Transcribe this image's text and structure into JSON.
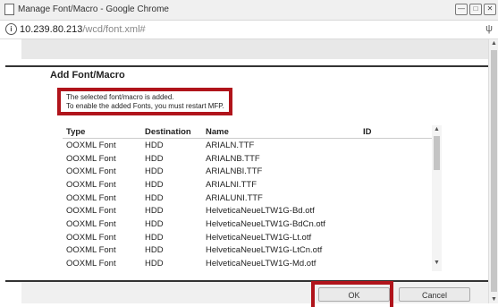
{
  "window": {
    "title": "Manage Font/Macro - Google Chrome",
    "minimize_glyph": "—",
    "maximize_glyph": "□",
    "close_glyph": "✕"
  },
  "address_bar": {
    "info_glyph": "i",
    "host": "10.239.80.213",
    "path": "/wcd/font.xml#",
    "extension_glyph": "ψ"
  },
  "dialog": {
    "title": "Add Font/Macro",
    "message_line1": "The selected font/macro is added.",
    "message_line2": "To enable the added Fonts, you must restart MFP."
  },
  "table": {
    "headers": [
      "Type",
      "Destination",
      "Name",
      "ID"
    ],
    "rows": [
      [
        "OOXML Font",
        "HDD",
        "ARIALN.TTF",
        ""
      ],
      [
        "OOXML Font",
        "HDD",
        "ARIALNB.TTF",
        ""
      ],
      [
        "OOXML Font",
        "HDD",
        "ARIALNBI.TTF",
        ""
      ],
      [
        "OOXML Font",
        "HDD",
        "ARIALNI.TTF",
        ""
      ],
      [
        "OOXML Font",
        "HDD",
        "ARIALUNI.TTF",
        ""
      ],
      [
        "OOXML Font",
        "HDD",
        "HelveticaNeueLTW1G-Bd.otf",
        ""
      ],
      [
        "OOXML Font",
        "HDD",
        "HelveticaNeueLTW1G-BdCn.otf",
        ""
      ],
      [
        "OOXML Font",
        "HDD",
        "HelveticaNeueLTW1G-Lt.otf",
        ""
      ],
      [
        "OOXML Font",
        "HDD",
        "HelveticaNeueLTW1G-LtCn.otf",
        ""
      ],
      [
        "OOXML Font",
        "HDD",
        "HelveticaNeueLTW1G-Md.otf",
        ""
      ]
    ]
  },
  "scroll": {
    "up_glyph": "▲",
    "down_glyph": "▼"
  },
  "buttons": {
    "ok": "OK",
    "cancel": "Cancel"
  },
  "colors": {
    "highlight": "#b0141b",
    "title_bar": "#f0f0f0"
  }
}
